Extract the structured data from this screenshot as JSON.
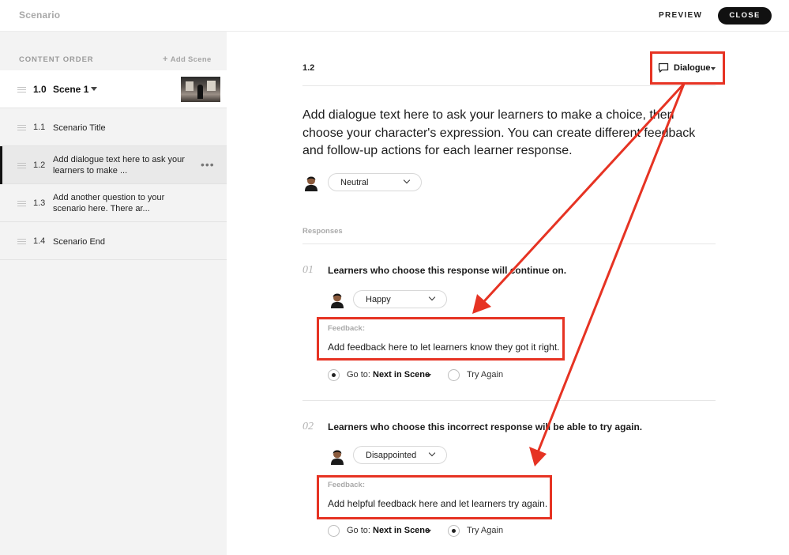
{
  "topbar": {
    "title": "Scenario",
    "preview": "PREVIEW",
    "close": "CLOSE"
  },
  "sidebar": {
    "header": "CONTENT ORDER",
    "add_scene": "Add Scene",
    "scene": {
      "number": "1.0",
      "name": "Scene 1"
    },
    "items": [
      {
        "number": "1.1",
        "label": "Scenario Title"
      },
      {
        "number": "1.2",
        "label": "Add dialogue text here to ask your learners to make ..."
      },
      {
        "number": "1.3",
        "label": "Add another question to your scenario here. There ar..."
      },
      {
        "number": "1.4",
        "label": "Scenario End"
      }
    ]
  },
  "main": {
    "number": "1.2",
    "type_label": "Dialogue",
    "question": "Add dialogue text here to ask your learners to make a choice, then choose your character's expression. You can create different feedback and follow-up actions for each learner response.",
    "expression": "Neutral",
    "responses_label": "Responses",
    "responses": [
      {
        "number": "01",
        "text": "Learners who choose this response will continue on.",
        "expression": "Happy",
        "feedback_label": "Feedback:",
        "feedback": "Add feedback here to let learners know they got it right.",
        "goto_label": "Go to:",
        "goto_value": "Next in Scene",
        "try_again": "Try Again",
        "selected": "goto"
      },
      {
        "number": "02",
        "text": "Learners who choose this incorrect response will be able to try again.",
        "expression": "Disappointed",
        "feedback_label": "Feedback:",
        "feedback": "Add helpful feedback here and let learners try again.",
        "goto_label": "Go to:",
        "goto_value": "Next in Scene",
        "try_again": "Try Again",
        "selected": "try_again"
      }
    ]
  },
  "colors": {
    "annotation": "#e63323",
    "sidebar_bg": "#f3f3f3",
    "active_item_bg": "#e9e9e9"
  },
  "icons": [
    "drag-handle-icon",
    "caret-down-icon",
    "chevron-down-icon",
    "more-dots-icon",
    "speech-bubble-icon",
    "avatar-icon",
    "radio-icon",
    "plus-icon"
  ]
}
